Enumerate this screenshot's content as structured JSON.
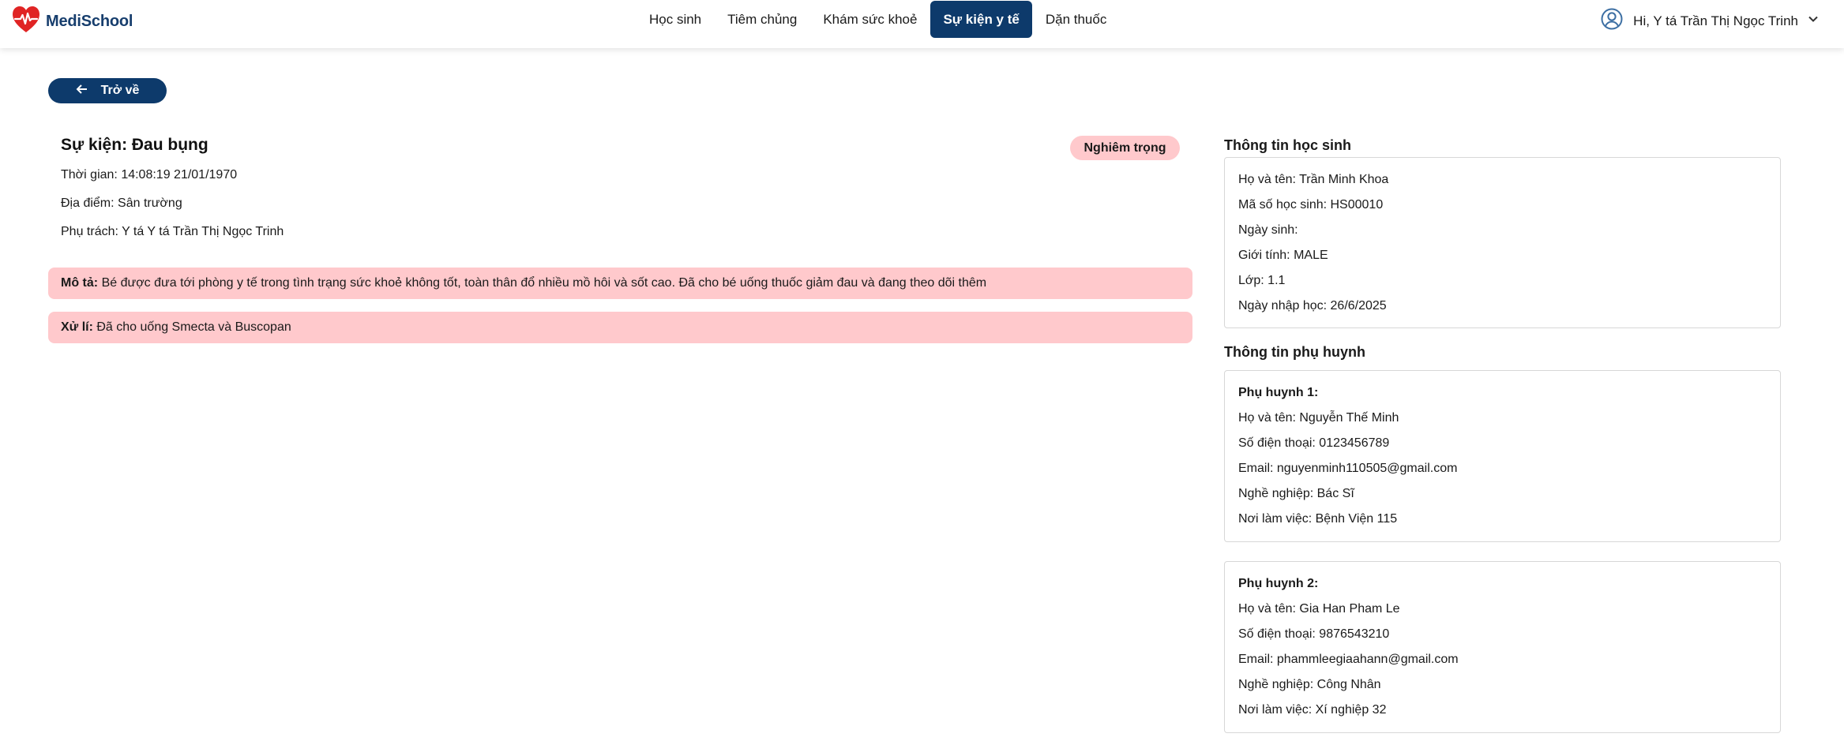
{
  "brand": {
    "name": "MediSchool",
    "color": "#e02424"
  },
  "nav": {
    "items": [
      {
        "label": "Học sinh"
      },
      {
        "label": "Tiêm chủng"
      },
      {
        "label": "Khám sức khoẻ"
      },
      {
        "label": "Sự kiện y tế",
        "active": true
      },
      {
        "label": "Dặn thuốc"
      }
    ]
  },
  "user": {
    "greeting": "Hi, Y tá Trần Thị Ngọc Trinh"
  },
  "back": {
    "label": "Trở về"
  },
  "event": {
    "title": "Sự kiện: Đau bụng",
    "severity": "Nghiêm trọng",
    "time_label": "Thời gian:",
    "time_value": "14:08:19 21/01/1970",
    "place_label": "Địa điểm:",
    "place_value": "Sân trường",
    "owner_label": "Phụ trách:",
    "owner_value": "Y tá Y tá Trần Thị Ngọc Trinh",
    "desc_label": "Mô tả:",
    "desc_value": "Bé được đưa tới phòng y tế trong tình trạng sức khoẻ không tốt, toàn thân đổ nhiều mồ hôi và sốt cao. Đã cho bé uống thuốc giảm đau và đang theo dõi thêm",
    "action_label": "Xử lí:",
    "action_value": "Đã cho uống Smecta và Buscopan"
  },
  "student": {
    "title": "Thông tin học sinh",
    "rows": [
      "Họ và tên: Trần Minh Khoa",
      "Mã số học sinh: HS00010",
      "Ngày sinh:",
      "Giới tính: MALE",
      "Lớp: 1.1",
      "Ngày nhập học: 26/6/2025"
    ]
  },
  "parents": {
    "title": "Thông tin phụ huynh",
    "list": [
      {
        "heading": "Phụ huynh 1:",
        "rows": [
          "Họ và tên: Nguyễn Thế Minh",
          "Số điện thoại: 0123456789",
          "Email: nguyenminh110505@gmail.com",
          "Nghề nghiệp: Bác Sĩ",
          "Nơi làm việc: Bệnh Viện 115"
        ]
      },
      {
        "heading": "Phụ huynh 2:",
        "rows": [
          "Họ và tên: Gia Han Pham Le",
          "Số điện thoại: 9876543210",
          "Email: phammleegiaahann@gmail.com",
          "Nghề nghiệp: Công Nhân",
          "Nơi làm việc: Xí nghiệp 32"
        ]
      }
    ]
  },
  "colors": {
    "primary": "#0d3a6b",
    "alert_bg": "#ffc9cc"
  }
}
